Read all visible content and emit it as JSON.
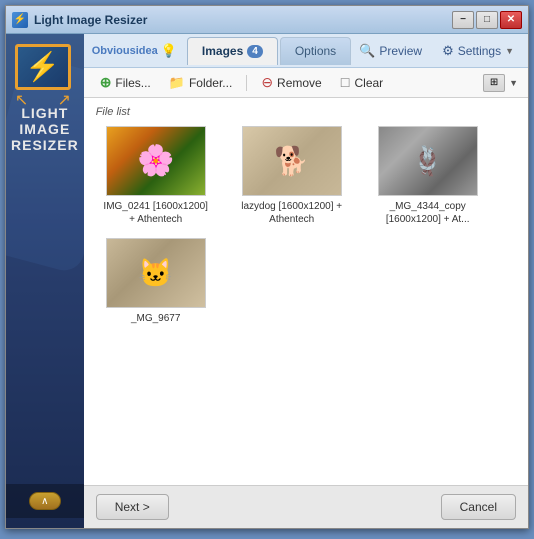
{
  "window": {
    "title": "Light Image Resizer",
    "minimize_label": "−",
    "maximize_label": "□",
    "close_label": "✕"
  },
  "sidebar": {
    "brand_line1": "LIGHT",
    "brand_line2": "IMAGE",
    "brand_line3": "RESIZER",
    "bottom_arrow": "∧"
  },
  "tabs": [
    {
      "label": "Images",
      "badge": "4",
      "active": true
    },
    {
      "label": "Options",
      "badge": "",
      "active": false
    }
  ],
  "header_right": {
    "preview_label": "Preview",
    "settings_label": "Settings"
  },
  "toolbar": {
    "files_label": "Files...",
    "folder_label": "Folder...",
    "remove_label": "Remove",
    "clear_label": "Clear"
  },
  "file_list": {
    "section_label": "File list",
    "items": [
      {
        "name": "IMG_0241\n[1600x1200] +\nAthentech",
        "thumb_type": "flowers"
      },
      {
        "name": "lazydog [1600x1200]\n+ Athentech",
        "thumb_type": "dog"
      },
      {
        "name": "_MG_4344_copy\n[1600x1200] + At...",
        "thumb_type": "rope"
      },
      {
        "name": "_MG_9677",
        "thumb_type": "cat"
      }
    ]
  },
  "bottom": {
    "next_label": "Next >",
    "cancel_label": "Cancel"
  }
}
